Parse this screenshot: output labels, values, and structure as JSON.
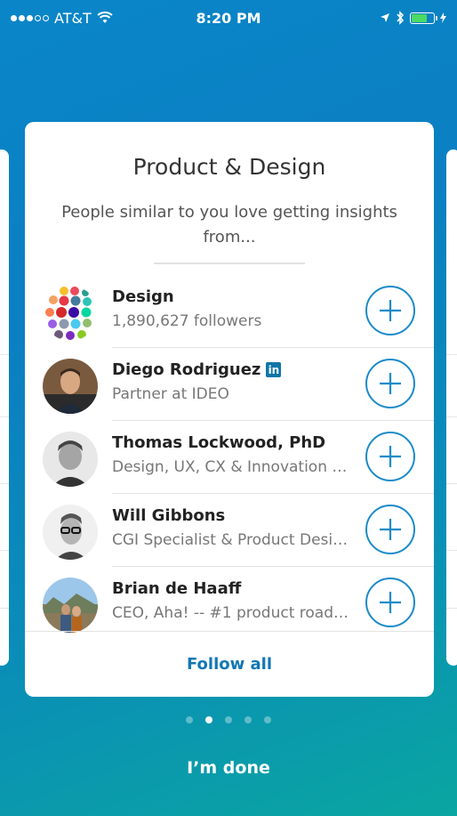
{
  "status_bar": {
    "carrier": "AT&T",
    "time": "8:20 PM"
  },
  "card": {
    "title": "Product & Design",
    "subtitle": "People similar to you love getting insights from...",
    "items": [
      {
        "name": "Design",
        "description": "1,890,627 followers",
        "linkedin_badge": false
      },
      {
        "name": "Diego Rodriguez",
        "description": "Partner at IDEO",
        "linkedin_badge": true,
        "badge_text": "in"
      },
      {
        "name": "Thomas Lockwood, PhD",
        "description": "Design, UX, CX & Innovation E…",
        "linkedin_badge": false
      },
      {
        "name": "Will Gibbons",
        "description": "CGI Specialist & Product Desi…",
        "linkedin_badge": false
      },
      {
        "name": "Brian de Haaff",
        "description": "CEO, Aha! -- #1 product road…",
        "linkedin_badge": false
      }
    ],
    "follow_all_label": "Follow all"
  },
  "pager": {
    "count": 5,
    "active_index": 1
  },
  "done_label": "I’m done",
  "colors": {
    "accent": "#1a8bc9",
    "link": "#1177b5",
    "linkedin": "#0e76a8",
    "gradient_start": "#0a86c8",
    "gradient_end": "#0aa6a1"
  }
}
